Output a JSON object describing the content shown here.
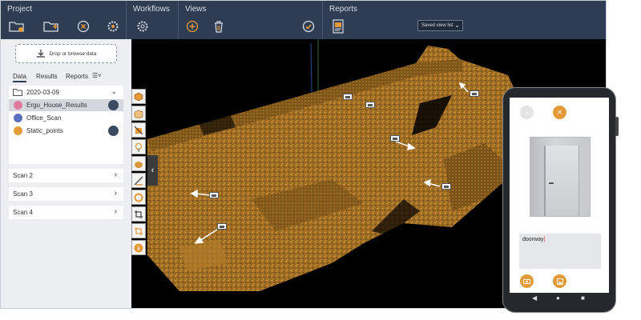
{
  "ribbon": {
    "groups": [
      {
        "title": "Project"
      },
      {
        "title": "Workflows"
      },
      {
        "title": "Views"
      },
      {
        "title": "Reports"
      }
    ],
    "view_select": "Saved view list"
  },
  "left_panel": {
    "dropzone_label": "Drop or browse data",
    "tabs": [
      "Data",
      "Results",
      "Reports"
    ],
    "tree": [
      {
        "label": "2020-03-09"
      },
      {
        "label": "Ergo_House_Results"
      },
      {
        "label": "Office_Scan"
      },
      {
        "label": "Static_points"
      }
    ],
    "scans": [
      "Scan 2",
      "Scan 3",
      "Scan 4"
    ]
  },
  "phone": {
    "note": "doorway"
  },
  "colors": {
    "ribbon": "#2e3d52",
    "accent_orange": "#e59a3a",
    "point_cloud": "#c98a2e",
    "panel": "#eceef1"
  }
}
